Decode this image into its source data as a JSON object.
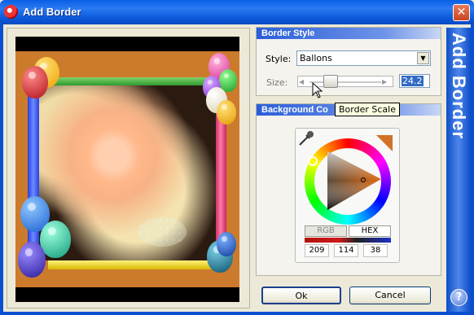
{
  "window": {
    "title": "Add Border",
    "close_glyph": "✕"
  },
  "sidebar_banner": {
    "text": "Add Border",
    "help_glyph": "?"
  },
  "border_style": {
    "heading": "Border Style",
    "style_label": "Style:",
    "style_value": "Ballons",
    "size_label": "Size:",
    "size_value": "24.2",
    "tooltip": "Border Scale"
  },
  "background": {
    "heading": "Background Co",
    "mode_buttons": [
      "RGB",
      "HEX"
    ],
    "values": [
      "209",
      "114",
      "38"
    ],
    "selected_color": "#d17226"
  },
  "buttons": {
    "ok": "Ok",
    "cancel": "Cancel"
  },
  "colors": {
    "title_bar": "#0a5fe4",
    "group_header": "#2a5ed9",
    "frame_orange": "#cc7a2c"
  },
  "icons": [
    "app-icon",
    "close-icon",
    "eyedropper-icon",
    "dropdown-arrow-icon",
    "slider-left-arrow-icon",
    "slider-right-arrow-icon",
    "color-wheel",
    "help-icon"
  ]
}
